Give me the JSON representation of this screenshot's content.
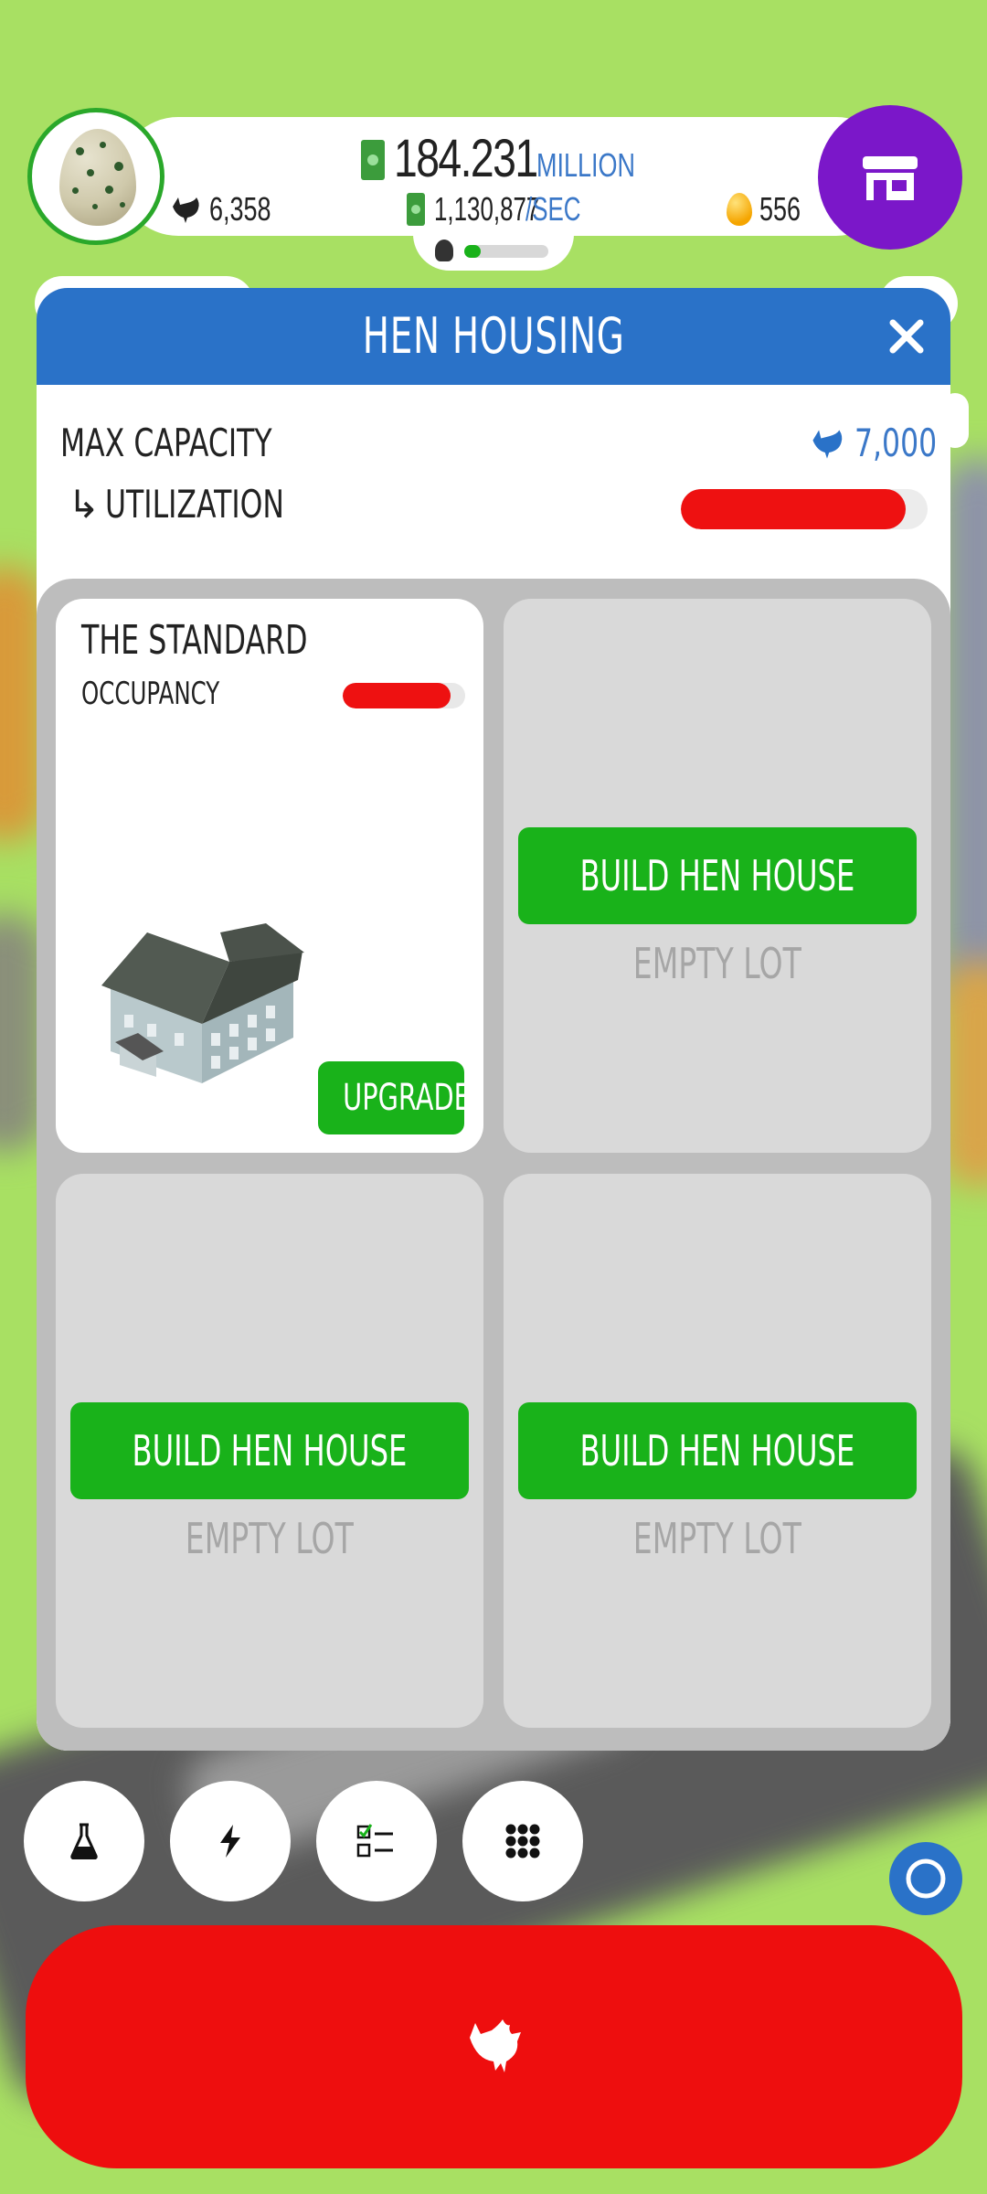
{
  "header": {
    "money_value": "184.231",
    "money_unit": "MILLION",
    "hen_count": "6,358",
    "rate_value": "1,130,877",
    "rate_unit": "/SEC",
    "golden_eggs": "556",
    "progress": 0.2,
    "shop_icon": "shop-icon"
  },
  "panel": {
    "title": "HEN HOUSING",
    "close_icon": "close-icon",
    "max_capacity_label": "MAX CAPACITY",
    "max_capacity_value": "7,000",
    "utilization_label": "UTILIZATION",
    "utilization_arrow": "↳",
    "utilization": 0.91
  },
  "lots": [
    {
      "name": "THE STANDARD",
      "occupancy_label": "OCCUPANCY",
      "occupancy": 0.88,
      "action": "UPGRADE"
    },
    {
      "action": "BUILD HEN HOUSE",
      "status": "EMPTY LOT"
    },
    {
      "action": "BUILD HEN HOUSE",
      "status": "EMPTY LOT"
    },
    {
      "action": "BUILD HEN HOUSE",
      "status": "EMPTY LOT"
    }
  ],
  "bottom_bar": {
    "buttons": [
      "research-icon",
      "boost-icon",
      "missions-icon",
      "menu-grid-icon"
    ],
    "ring_icon": "ring-icon",
    "hatch_icon": "chicken-icon"
  },
  "colors": {
    "background": "#a8e063",
    "header_blue": "#2a72c8",
    "green": "#19b21a",
    "red": "#ee0e0e",
    "purple": "#7b17c9"
  }
}
